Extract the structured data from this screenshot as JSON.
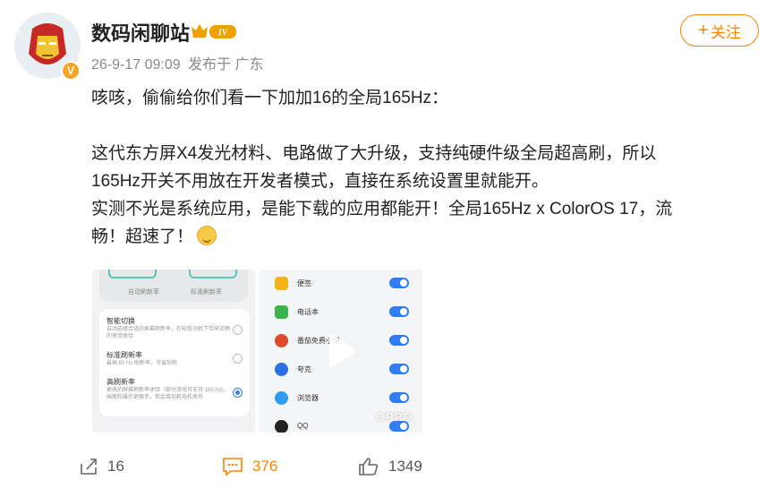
{
  "post": {
    "username": "数码闲聊站",
    "vip_level": "IV",
    "avatar_badge": "V",
    "time": "26-9-17 09:09",
    "source": "发布于 广东",
    "follow_label": "关注",
    "text_line1": "咳咳，偷偷给你们看一下加加16的全局165Hz：",
    "text_para2_a": "这代东方屏X4发光材料、电路做了大升级，支持纯硬件级全局超高刷，所以",
    "text_para2_b": "165Hz开关不用放在开发者模式，直接在系统设置里就能开。",
    "text_para3_a": "实测不光是系统应用，是能下载的应用都能开！全局165Hz x ColorOS 17，流",
    "text_para3_b": "畅！超速了！"
  },
  "image1": {
    "top_left_caption": "自动刷新率",
    "top_right_caption": "标准刷新率",
    "options": [
      {
        "title": "智能切换",
        "desc": "自动选择合适的屏幕刷新率，在较低功耗下带来流畅的使用体验",
        "selected": false
      },
      {
        "title": "标准刷新率",
        "desc": "最高 60 Hz 刷新率，节省功耗",
        "selected": false
      },
      {
        "title": "高刷新率",
        "desc": "更高的屏幕刷新率体验（部分游戏可支持 165 Hz)，画面和操作更跟手，但会增加耗电和发热",
        "selected": true
      }
    ]
  },
  "image2": {
    "apps": [
      {
        "name": "便签",
        "icon": "notes-icon",
        "color": "#f5b21a",
        "on": true
      },
      {
        "name": "电话本",
        "icon": "contacts-icon",
        "color": "#3bb54a",
        "on": true
      },
      {
        "name": "番茄免费小说",
        "icon": "novel-icon",
        "color": "#e04a2c",
        "on": true
      },
      {
        "name": "夸克",
        "icon": "quark-icon",
        "color": "#2b6fe6",
        "on": true
      },
      {
        "name": "浏览器",
        "icon": "browser-icon",
        "color": "#2e9cf0",
        "on": true
      },
      {
        "name": "QQ",
        "icon": "qq-icon",
        "color": "#222222",
        "on": true
      }
    ],
    "watermark": "OPPO"
  },
  "footer": {
    "share_count": "16",
    "comment_count": "376",
    "like_count": "1349"
  },
  "colors": {
    "accent": "#ff8200",
    "toggle_blue": "#2e7cf6"
  }
}
